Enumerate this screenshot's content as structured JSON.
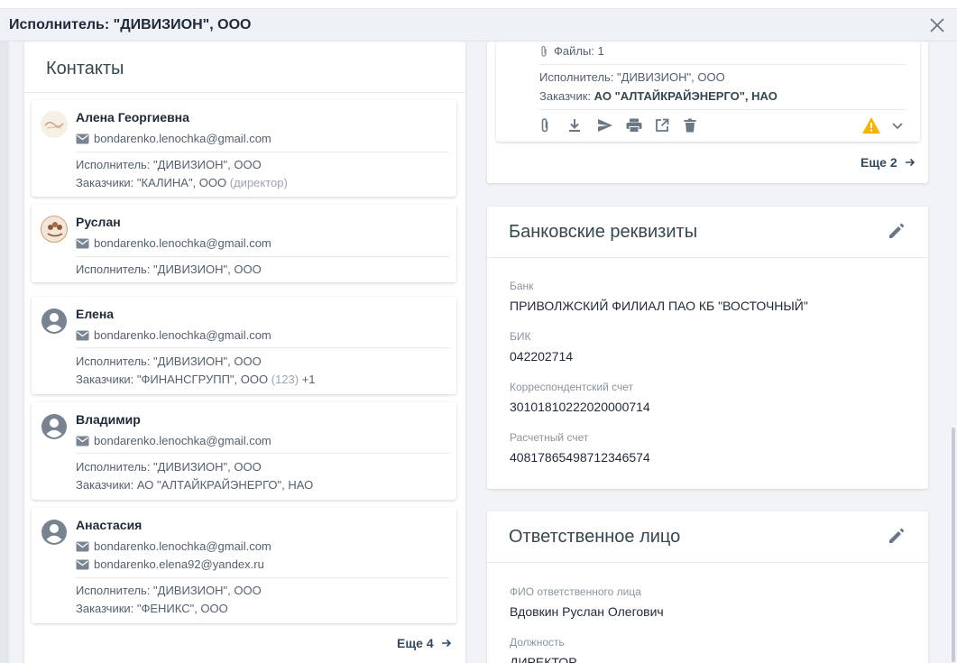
{
  "window": {
    "title": "Исполнитель: \"ДИВИЗИОН\", ООО"
  },
  "contacts": {
    "title": "Контакты",
    "more": "Еще 4",
    "items": [
      {
        "name": "Алена Георгиевна",
        "avatar": "logo-avatar",
        "emails": [
          "bondarenko.lenochka@gmail.com"
        ],
        "executor": "Исполнитель: \"ДИВИЗИОН\", ООО",
        "customers": "Заказчики: \"КАЛИНА\", ООО",
        "customers_note": "(директор)",
        "customers_extra": ""
      },
      {
        "name": "Руслан",
        "avatar": "logo-avatar",
        "emails": [
          "bondarenko.lenochka@gmail.com"
        ],
        "executor": "Исполнитель: \"ДИВИЗИОН\", ООО"
      },
      {
        "name": "Елена",
        "avatar": "person-icon",
        "emails": [
          "bondarenko.lenochka@gmail.com"
        ],
        "executor": "Исполнитель: \"ДИВИЗИОН\", ООО",
        "customers": "Заказчики: \"ФИНАНСГРУПП\", ООО",
        "customers_note": "(123)",
        "customers_extra": "+1"
      },
      {
        "name": "Владимир",
        "avatar": "person-icon",
        "emails": [
          "bondarenko.lenochka@gmail.com"
        ],
        "executor": "Исполнитель: \"ДИВИЗИОН\", ООО",
        "customers": "Заказчики: АО \"АЛТАЙКРАЙЭНЕРГО\", НАО"
      },
      {
        "name": "Анастасия",
        "avatar": "person-icon",
        "emails": [
          "bondarenko.lenochka@gmail.com",
          "bondarenko.elena92@yandex.ru"
        ],
        "executor": "Исполнитель: \"ДИВИЗИОН\", ООО",
        "customers": "Заказчики: \"ФЕНИКС\", ООО"
      }
    ]
  },
  "document": {
    "files": "Файлы: 1",
    "executor": "Исполнитель: \"ДИВИЗИОН\", ООО",
    "customer_label": "Заказчик:",
    "customer_value": "АО \"АЛТАЙКРАЙЭНЕРГО\", НАО",
    "actions": [
      "attach-icon",
      "download-icon",
      "send-icon",
      "print-icon",
      "open-external-icon",
      "delete-icon"
    ],
    "more": "Еще 2"
  },
  "bank": {
    "title": "Банковские реквизиты",
    "fields": [
      {
        "label": "Банк",
        "value": "ПРИВОЛЖСКИЙ ФИЛИАЛ ПАО КБ \"ВОСТОЧНЫЙ\""
      },
      {
        "label": "БИК",
        "value": "042202714"
      },
      {
        "label": "Корреспондентский счет",
        "value": "30101810222020000714"
      },
      {
        "label": "Расчетный счет",
        "value": "40817865498712346574"
      }
    ]
  },
  "responsible": {
    "title": "Ответственное лицо",
    "fields": [
      {
        "label": "ФИО ответственного лица",
        "value": "Вдовкин Руслан Олегович"
      },
      {
        "label": "Должность",
        "value": "ДИРЕКТОР"
      }
    ]
  },
  "colors": {
    "accent": "#34495e",
    "warning": "#f5b400",
    "icon": "#6b7785"
  }
}
